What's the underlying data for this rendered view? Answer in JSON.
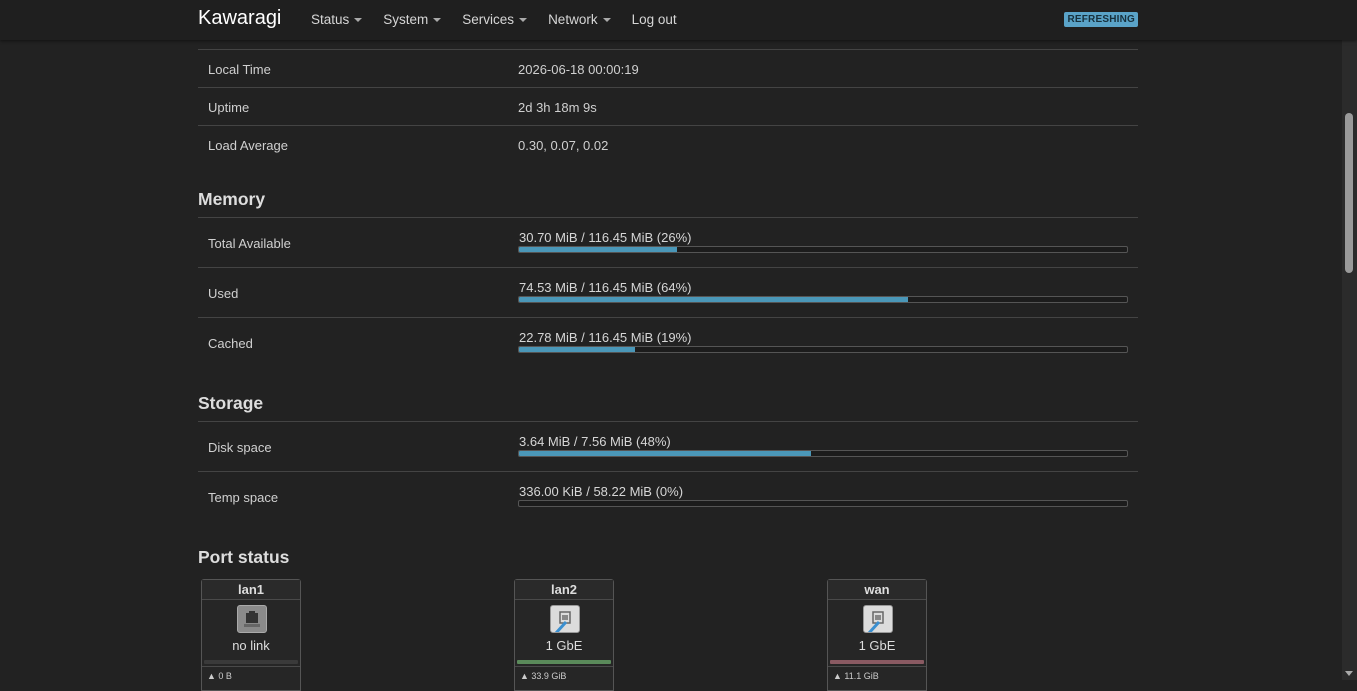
{
  "nav": {
    "brand": "Kawaragi",
    "menu": [
      {
        "label": "Status",
        "dropdown": true
      },
      {
        "label": "System",
        "dropdown": true
      },
      {
        "label": "Services",
        "dropdown": true
      },
      {
        "label": "Network",
        "dropdown": true
      },
      {
        "label": "Log out",
        "dropdown": false
      }
    ],
    "badge": "REFRESHING"
  },
  "system": [
    {
      "key": "Local Time",
      "value": "2026-06-18 00:00:19"
    },
    {
      "key": "Uptime",
      "value": "2d 3h 18m 9s"
    },
    {
      "key": "Load Average",
      "value": "0.30, 0.07, 0.02"
    }
  ],
  "memory": {
    "title": "Memory",
    "rows": [
      {
        "key": "Total Available",
        "text": "30.70 MiB / 116.45 MiB (26%)",
        "fraction": 0.26
      },
      {
        "key": "Used",
        "text": "74.53 MiB / 116.45 MiB (64%)",
        "fraction": 0.64
      },
      {
        "key": "Cached",
        "text": "22.78 MiB / 116.45 MiB (19%)",
        "fraction": 0.19
      }
    ]
  },
  "storage": {
    "title": "Storage",
    "rows": [
      {
        "key": "Disk space",
        "text": "3.64 MiB / 7.56 MiB (48%)",
        "fraction": 0.48
      },
      {
        "key": "Temp space",
        "text": "336.00 KiB / 58.22 MiB (0%)",
        "fraction": 0.0
      }
    ]
  },
  "ports": {
    "title": "Port status",
    "items": [
      {
        "name": "lan1",
        "speed": "no link",
        "traffic": "▲ 0 B",
        "linked": false,
        "line_color": "#3a3a3a"
      },
      {
        "name": "lan2",
        "speed": "1 GbE",
        "traffic": "▲ 33.9 GiB",
        "linked": true,
        "line_color": "#5a8a5a"
      },
      {
        "name": "wan",
        "speed": "1 GbE",
        "traffic": "▲ 11.1 GiB",
        "linked": true,
        "line_color": "#8a5a62"
      }
    ]
  },
  "colors": {
    "accent": "#4a97b8",
    "background": "#222222"
  }
}
